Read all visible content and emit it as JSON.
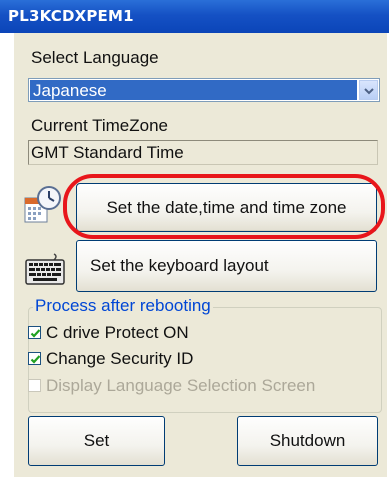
{
  "window": {
    "title": "PL3KCDXPEM1"
  },
  "language": {
    "label": "Select Language",
    "selected": "Japanese"
  },
  "timezone": {
    "label": "Current TimeZone",
    "value": "GMT Standard Time"
  },
  "buttons": {
    "datetime": "Set the date,time and time zone",
    "keyboard": "Set the keyboard layout",
    "set": "Set",
    "shutdown": "Shutdown"
  },
  "process_group": {
    "legend": "Process after rebooting",
    "options": [
      {
        "label": "C drive Protect ON",
        "checked": true,
        "enabled": true
      },
      {
        "label": "Change Security ID",
        "checked": true,
        "enabled": true
      },
      {
        "label": "Display Language Selection Screen",
        "checked": false,
        "enabled": false
      }
    ]
  },
  "icons": {
    "datetime": "calendar-clock-icon",
    "keyboard": "keyboard-icon",
    "dropdown": "chevron-down-icon",
    "checkmark": "checkmark-icon"
  },
  "colors": {
    "titlebar": "#0b45b8",
    "panel": "#ece9d8",
    "selection": "#316ac5",
    "highlight_ring": "#e8161b",
    "group_legend": "#0046d5"
  }
}
